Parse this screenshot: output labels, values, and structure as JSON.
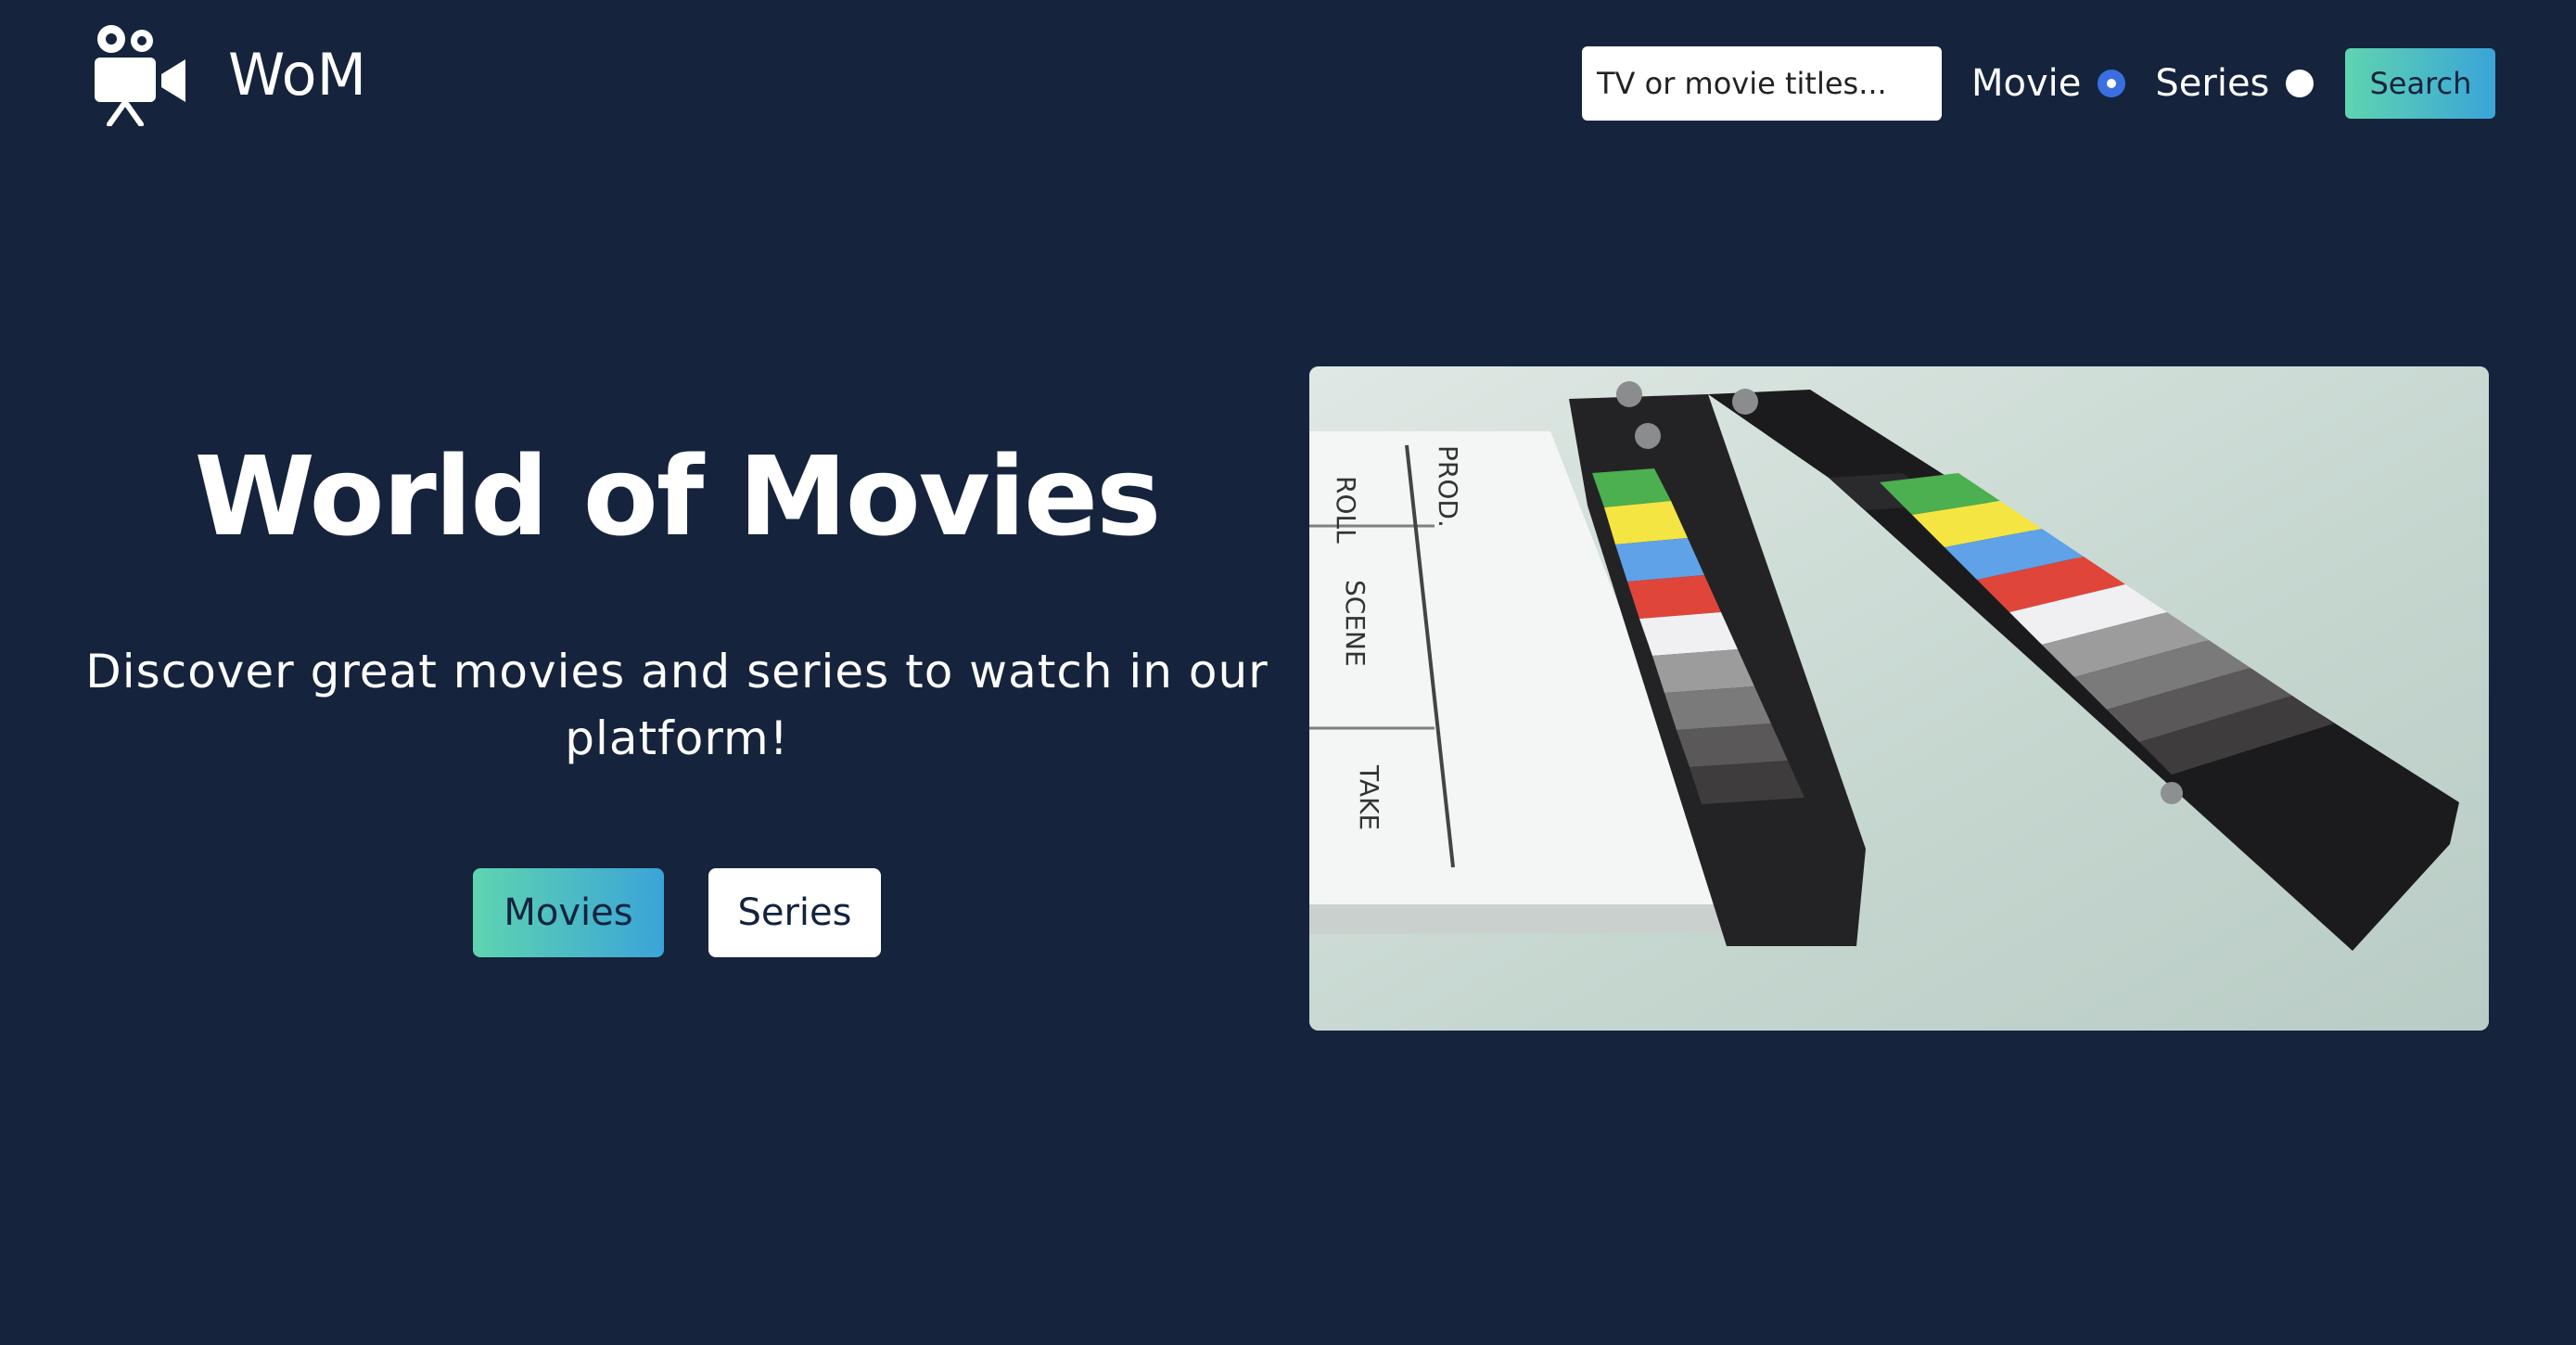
{
  "navbar": {
    "logo_icon": "movie-camera-icon",
    "brand": "WoM",
    "search": {
      "placeholder": "TV or movie titles...",
      "value": ""
    },
    "radio_movie": {
      "label": "Movie",
      "checked": true
    },
    "radio_series": {
      "label": "Series",
      "checked": false
    },
    "search_button": "Search"
  },
  "hero": {
    "title": "World of Movies",
    "subtitle": "Discover great movies and series to watch in our platform!",
    "buttons": {
      "movies": "Movies",
      "series": "Series"
    },
    "image_icon": "clapperboard-image"
  },
  "colors": {
    "background": "#15233c",
    "accent_gradient_start": "#5fd4b0",
    "accent_gradient_end": "#3aa4d8",
    "radio_checked": "#3b6fe0"
  }
}
